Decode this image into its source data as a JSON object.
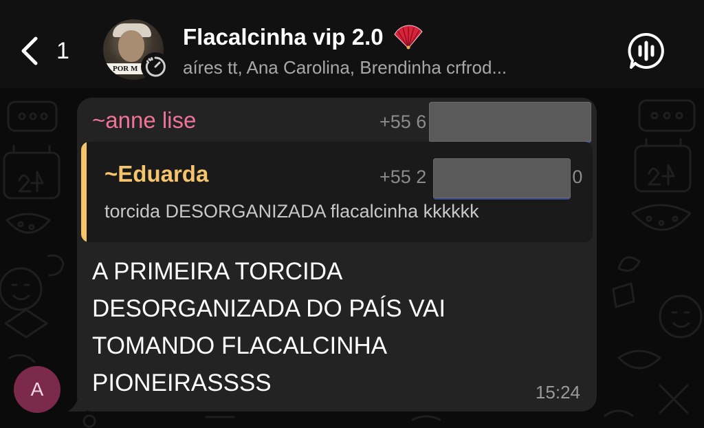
{
  "header": {
    "back_count": "1",
    "group_title": "Flacalcinha vip 2.0",
    "group_members": "aíres tt, Ana Carolina, Brendinha crfrod...",
    "avatar_photo_label": "POR M",
    "icons": {
      "back": "chevron-left-icon",
      "title_emoji": "folding-fan-icon",
      "timer": "disappearing-timer-icon",
      "call": "voice-chat-icon"
    }
  },
  "message": {
    "sender_name": "~anne lise",
    "sender_phone": "+55 6",
    "quote": {
      "name": "~Eduarda",
      "phone": "+55 2",
      "phone_tail": "0",
      "text": "torcida DESORGANIZADA flacalcinha kkkkkk"
    },
    "text": "A PRIMEIRA TORCIDA\nDESORGANIZADA DO PAÍS VAI\nTOMANDO FLACALCINHA\nPIONEIRASSSS",
    "time": "15:24",
    "avatar_letter": "A"
  },
  "colors": {
    "background": "#0b0b0b",
    "header": "#111111",
    "bubble": "#232323",
    "quote_bg": "#1a1a1a",
    "sender_name": "#f0739a",
    "quote_accent": "#f5c46d",
    "avatar": "#7c2a4c"
  }
}
